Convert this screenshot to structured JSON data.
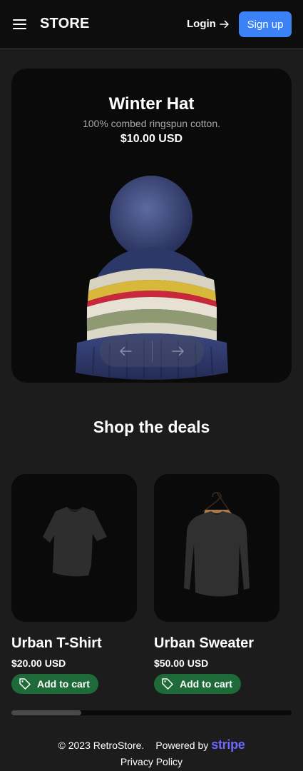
{
  "header": {
    "logo": "STORE",
    "login_label": "Login",
    "signup_label": "Sign up"
  },
  "hero": {
    "title": "Winter Hat",
    "description": "100% combed ringspun cotton.",
    "price": "$10.00 USD"
  },
  "deals": {
    "title": "Shop the deals",
    "products": [
      {
        "name": "Urban T-Shirt",
        "price": "$20.00 USD",
        "button": "Add to cart"
      },
      {
        "name": "Urban Sweater",
        "price": "$50.00 USD",
        "button": "Add to cart"
      }
    ],
    "scroll_position": 0.25
  },
  "footer": {
    "copyright": "© 2023 RetroStore.",
    "powered_by": "Powered by",
    "stripe": "stripe",
    "privacy": "Privacy Policy"
  },
  "colors": {
    "accent": "#3b82f6",
    "cart_button": "#1e6b39",
    "stripe": "#6f68ff",
    "background": "#1c1c1c"
  }
}
